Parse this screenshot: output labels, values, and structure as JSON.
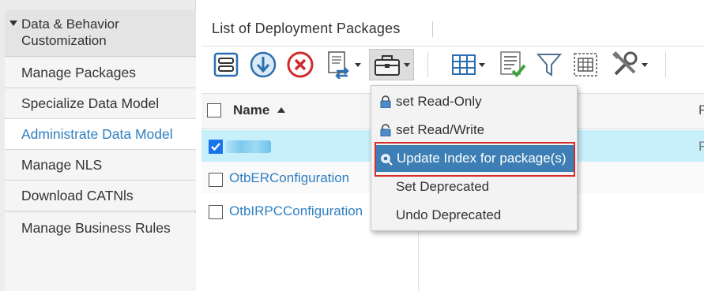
{
  "sidebar": {
    "header": "Data & Behavior Customization",
    "items": [
      {
        "label": "Manage Packages",
        "active": false
      },
      {
        "label": "Specialize Data Model",
        "active": false
      },
      {
        "label": "Administrate Data Model",
        "active": true
      },
      {
        "label": "Manage NLS",
        "active": false
      },
      {
        "label": "Download CATNls",
        "active": false
      },
      {
        "label": "Manage Business Rules",
        "active": false
      }
    ]
  },
  "main": {
    "title": "List of Deployment Packages",
    "toolbar": [
      {
        "icon": "properties-icon"
      },
      {
        "icon": "download-icon"
      },
      {
        "icon": "delete-icon"
      },
      {
        "icon": "export-document-icon",
        "dropdown": true
      },
      {
        "icon": "toolbox-icon",
        "dropdown": true,
        "active": true
      },
      {
        "icon": "grid-view-icon",
        "dropdown": true
      },
      {
        "icon": "validate-list-icon"
      },
      {
        "icon": "filter-icon"
      },
      {
        "icon": "select-table-icon"
      },
      {
        "icon": "tools-icon",
        "dropdown": true
      }
    ],
    "table": {
      "columns": [
        "Name",
        "F"
      ],
      "rows": [
        {
          "name": "",
          "checked": true,
          "selected": true,
          "second": "F"
        },
        {
          "name": "OtbERConfiguration",
          "checked": false
        },
        {
          "name": "OtbIRPCConfiguration",
          "checked": false
        }
      ]
    },
    "menu": {
      "items": [
        {
          "label": "set Read-Only",
          "icon": "lock-icon"
        },
        {
          "label": "set Read/Write",
          "icon": "unlock-icon"
        },
        {
          "label": "Update Index for package(s)",
          "icon": "index-icon",
          "highlighted": true
        },
        {
          "label": "Set Deprecated"
        },
        {
          "label": "Undo Deprecated"
        }
      ]
    }
  },
  "colors": {
    "link": "#2f7fc1",
    "selection": "#c7f0fb",
    "menu_highlight": "#3d7fb4",
    "annotation": "#d62c2c"
  }
}
